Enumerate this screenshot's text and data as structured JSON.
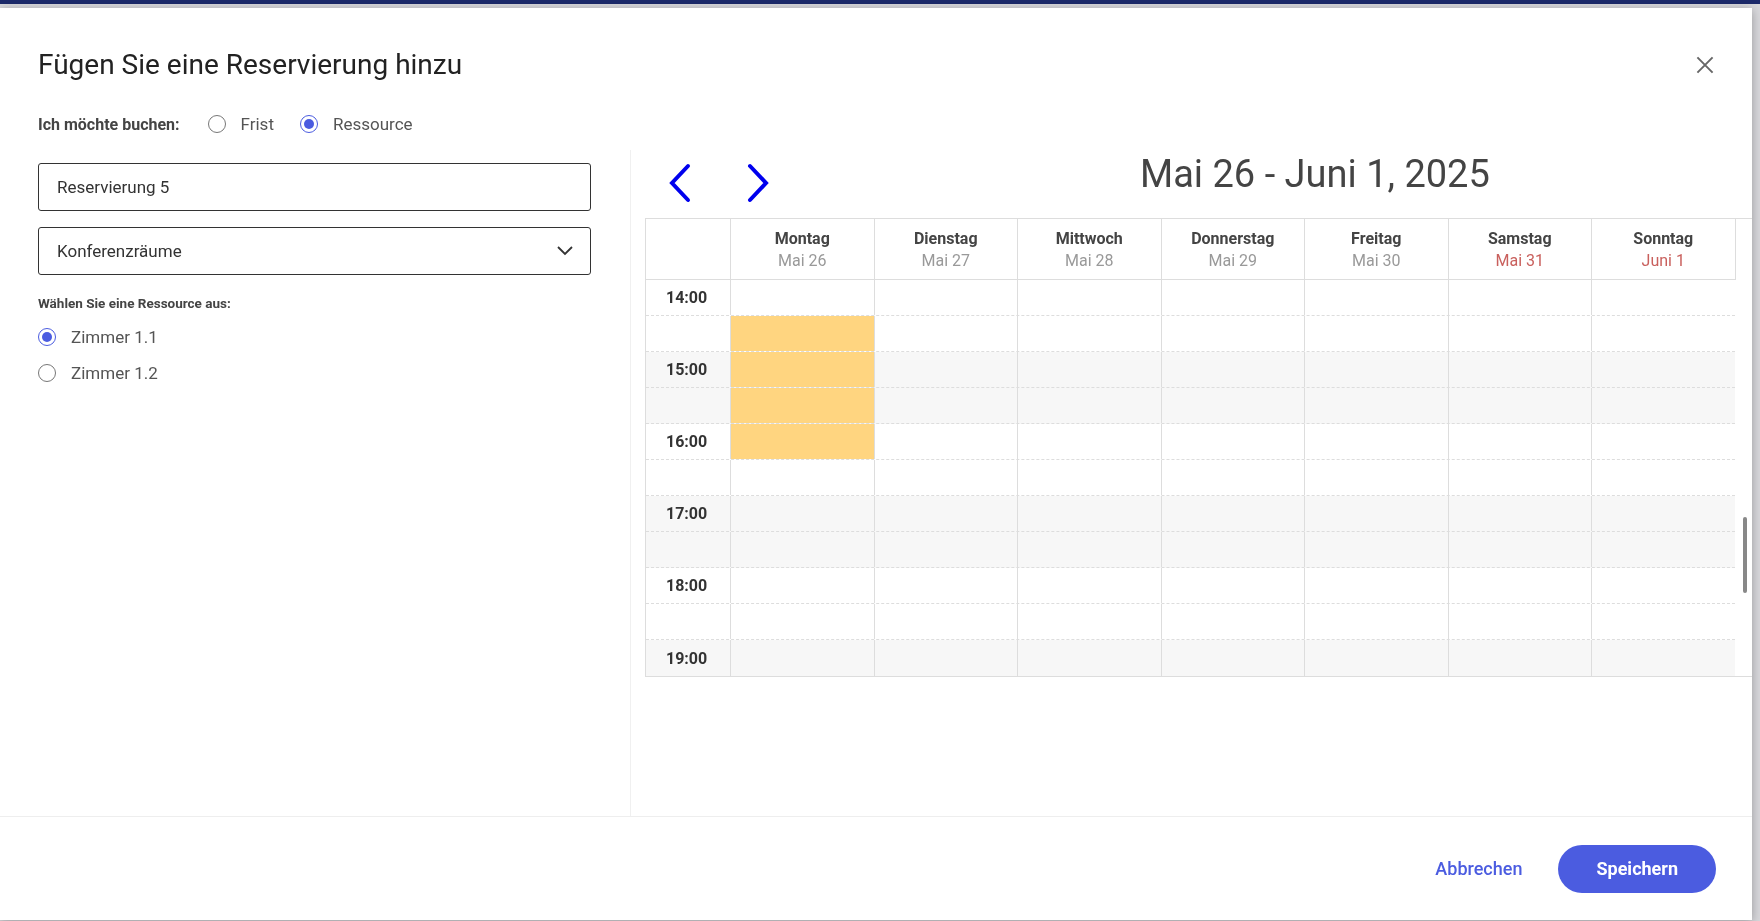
{
  "dialog": {
    "title": "Fügen Sie eine Reservierung hinzu"
  },
  "booking_type": {
    "label": "Ich möchte buchen:",
    "options": [
      {
        "label": "Frist",
        "selected": false
      },
      {
        "label": "Ressource",
        "selected": true
      }
    ]
  },
  "name_field": {
    "value": "Reservierung 5"
  },
  "category_select": {
    "value": "Konferenzräume"
  },
  "resource_label": "Wählen Sie eine Ressource aus:",
  "resources": [
    {
      "label": "Zimmer 1.1",
      "selected": true
    },
    {
      "label": "Zimmer 1.2",
      "selected": false
    }
  ],
  "calendar": {
    "range_title": "Mai 26 - Juni 1, 2025",
    "days": [
      {
        "name": "Montag",
        "date": "Mai 26",
        "weekend": false
      },
      {
        "name": "Dienstag",
        "date": "Mai 27",
        "weekend": false
      },
      {
        "name": "Mittwoch",
        "date": "Mai 28",
        "weekend": false
      },
      {
        "name": "Donnerstag",
        "date": "Mai 29",
        "weekend": false
      },
      {
        "name": "Freitag",
        "date": "Mai 30",
        "weekend": false
      },
      {
        "name": "Samstag",
        "date": "Mai 31",
        "weekend": true
      },
      {
        "name": "Sonntag",
        "date": "Juni 1",
        "weekend": true
      }
    ],
    "slots": [
      {
        "time": "14:00",
        "booked": [
          false,
          false,
          false,
          false,
          false,
          false,
          false
        ]
      },
      {
        "booked": [
          true,
          false,
          false,
          false,
          false,
          false,
          false
        ]
      },
      {
        "time": "15:00",
        "booked": [
          true,
          false,
          false,
          false,
          false,
          false,
          false
        ]
      },
      {
        "booked": [
          true,
          false,
          false,
          false,
          false,
          false,
          false
        ]
      },
      {
        "time": "16:00",
        "booked": [
          true,
          false,
          false,
          false,
          false,
          false,
          false
        ]
      },
      {
        "booked": [
          false,
          false,
          false,
          false,
          false,
          false,
          false
        ]
      },
      {
        "time": "17:00",
        "booked": [
          false,
          false,
          false,
          false,
          false,
          false,
          false
        ]
      },
      {
        "booked": [
          false,
          false,
          false,
          false,
          false,
          false,
          false
        ]
      },
      {
        "time": "18:00",
        "booked": [
          false,
          false,
          false,
          false,
          false,
          false,
          false
        ]
      },
      {
        "booked": [
          false,
          false,
          false,
          false,
          false,
          false,
          false
        ]
      },
      {
        "time": "19:00",
        "booked": [
          false,
          false,
          false,
          false,
          false,
          false,
          false
        ]
      }
    ]
  },
  "buttons": [
    {
      "label": "Abbrechen",
      "kind": "text"
    },
    {
      "label": "Speichern",
      "kind": "primary"
    }
  ]
}
